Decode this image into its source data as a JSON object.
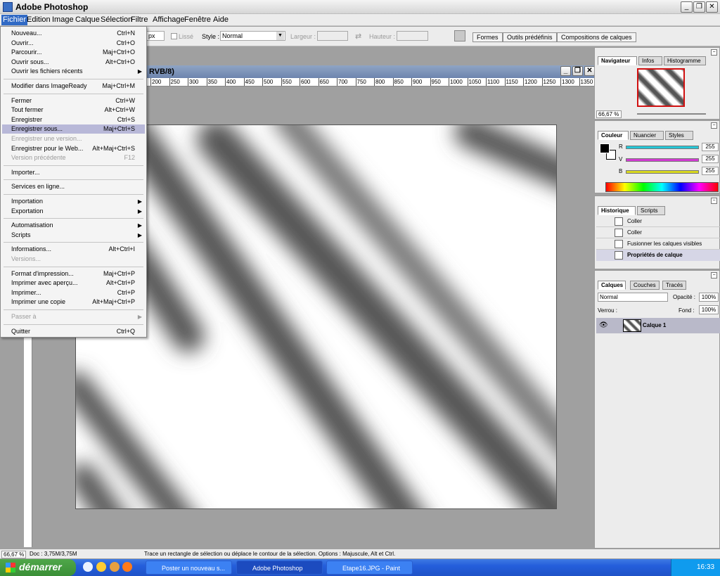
{
  "app": {
    "title": "Adobe Photoshop"
  },
  "menubar": [
    "Fichier",
    "Edition",
    "Image",
    "Calque",
    "Sélection",
    "Filtre",
    "Affichage",
    "Fenêtre",
    "Aide"
  ],
  "options": {
    "px_value": "px",
    "lisse": "Lissé",
    "style_label": "Style :",
    "style_value": "Normal",
    "largeur_label": "Largeur :",
    "hauteur_label": "Hauteur :",
    "tabs": [
      "Formes",
      "Outils prédéfinis",
      "Compositions de calques"
    ]
  },
  "file_menu": [
    {
      "label": "Nouveau...",
      "shortcut": "Ctrl+N"
    },
    {
      "label": "Ouvrir...",
      "shortcut": "Ctrl+O"
    },
    {
      "label": "Parcourir...",
      "shortcut": "Maj+Ctrl+O"
    },
    {
      "label": "Ouvrir sous...",
      "shortcut": "Alt+Ctrl+O"
    },
    {
      "label": "Ouvrir les fichiers récents",
      "shortcut": "",
      "submenu": true
    },
    {
      "sep": true
    },
    {
      "label": "Modifier dans ImageReady",
      "shortcut": "Maj+Ctrl+M"
    },
    {
      "sep": true
    },
    {
      "label": "Fermer",
      "shortcut": "Ctrl+W"
    },
    {
      "label": "Tout fermer",
      "shortcut": "Alt+Ctrl+W"
    },
    {
      "label": "Enregistrer",
      "shortcut": "Ctrl+S"
    },
    {
      "label": "Enregistrer sous...",
      "shortcut": "Maj+Ctrl+S",
      "highlight": true
    },
    {
      "label": "Enregistrer une version...",
      "shortcut": "",
      "disabled": true
    },
    {
      "label": "Enregistrer pour le Web...",
      "shortcut": "Alt+Maj+Ctrl+S"
    },
    {
      "label": "Version précédente",
      "shortcut": "F12",
      "disabled": true
    },
    {
      "sep": true
    },
    {
      "label": "Importer...",
      "shortcut": ""
    },
    {
      "sep": true
    },
    {
      "label": "Services en ligne...",
      "shortcut": ""
    },
    {
      "sep": true
    },
    {
      "label": "Importation",
      "shortcut": "",
      "submenu": true
    },
    {
      "label": "Exportation",
      "shortcut": "",
      "submenu": true
    },
    {
      "sep": true
    },
    {
      "label": "Automatisation",
      "shortcut": "",
      "submenu": true
    },
    {
      "label": "Scripts",
      "shortcut": "",
      "submenu": true
    },
    {
      "sep": true
    },
    {
      "label": "Informations...",
      "shortcut": "Alt+Ctrl+I"
    },
    {
      "label": "Versions...",
      "shortcut": "",
      "disabled": true
    },
    {
      "sep": true
    },
    {
      "label": "Format d'impression...",
      "shortcut": "Maj+Ctrl+P"
    },
    {
      "label": "Imprimer avec aperçu...",
      "shortcut": "Alt+Ctrl+P"
    },
    {
      "label": "Imprimer...",
      "shortcut": "Ctrl+P"
    },
    {
      "label": "Imprimer une copie",
      "shortcut": "Alt+Maj+Ctrl+P"
    },
    {
      "sep": true
    },
    {
      "label": "Passer à",
      "shortcut": "",
      "submenu": true,
      "disabled": true
    },
    {
      "sep": true
    },
    {
      "label": "Quitter",
      "shortcut": "Ctrl+Q"
    }
  ],
  "document": {
    "title_fragment": "RVB/8)",
    "ruler_ticks": [
      "200",
      "250",
      "300",
      "350",
      "400",
      "450",
      "500",
      "550",
      "600",
      "650",
      "700",
      "750",
      "800",
      "850",
      "900",
      "950",
      "1000",
      "1050",
      "1100",
      "1150",
      "1200",
      "1250",
      "1300",
      "1350"
    ]
  },
  "navigator": {
    "tabs": [
      "Navigateur",
      "Infos",
      "Histogramme"
    ],
    "zoom": "66,67 %"
  },
  "color": {
    "tabs": [
      "Couleur",
      "Nuancier",
      "Styles"
    ],
    "channels": [
      {
        "name": "R",
        "value": "255",
        "color": "#26c6d6"
      },
      {
        "name": "V",
        "value": "255",
        "color": "#d23ad2"
      },
      {
        "name": "B",
        "value": "255",
        "color": "#d8d820"
      }
    ]
  },
  "history": {
    "tabs": [
      "Historique",
      "Scripts"
    ],
    "items": [
      "Coller",
      "Coller",
      "Fusionner les calques visibles",
      "Propriétés de calque"
    ]
  },
  "layers": {
    "tabs": [
      "Calques",
      "Couches",
      "Tracés"
    ],
    "blend": "Normal",
    "opacity_label": "Opacité :",
    "opacity": "100%",
    "lock_label": "Verrou :",
    "fill_label": "Fond :",
    "fill": "100%",
    "layer_name": "Calque 1"
  },
  "status": {
    "zoom": "66,67 %",
    "doc": "Doc : 3,75M/3,75M",
    "hint": "Trace un rectangle de sélection ou déplace le contour de la sélection. Options : Majuscule, Alt et Ctrl."
  },
  "taskbar": {
    "start": "démarrer",
    "tasks": [
      "Poster un nouveau s...",
      "Adobe Photoshop",
      "Etape16.JPG - Paint"
    ],
    "time": "16:33"
  }
}
